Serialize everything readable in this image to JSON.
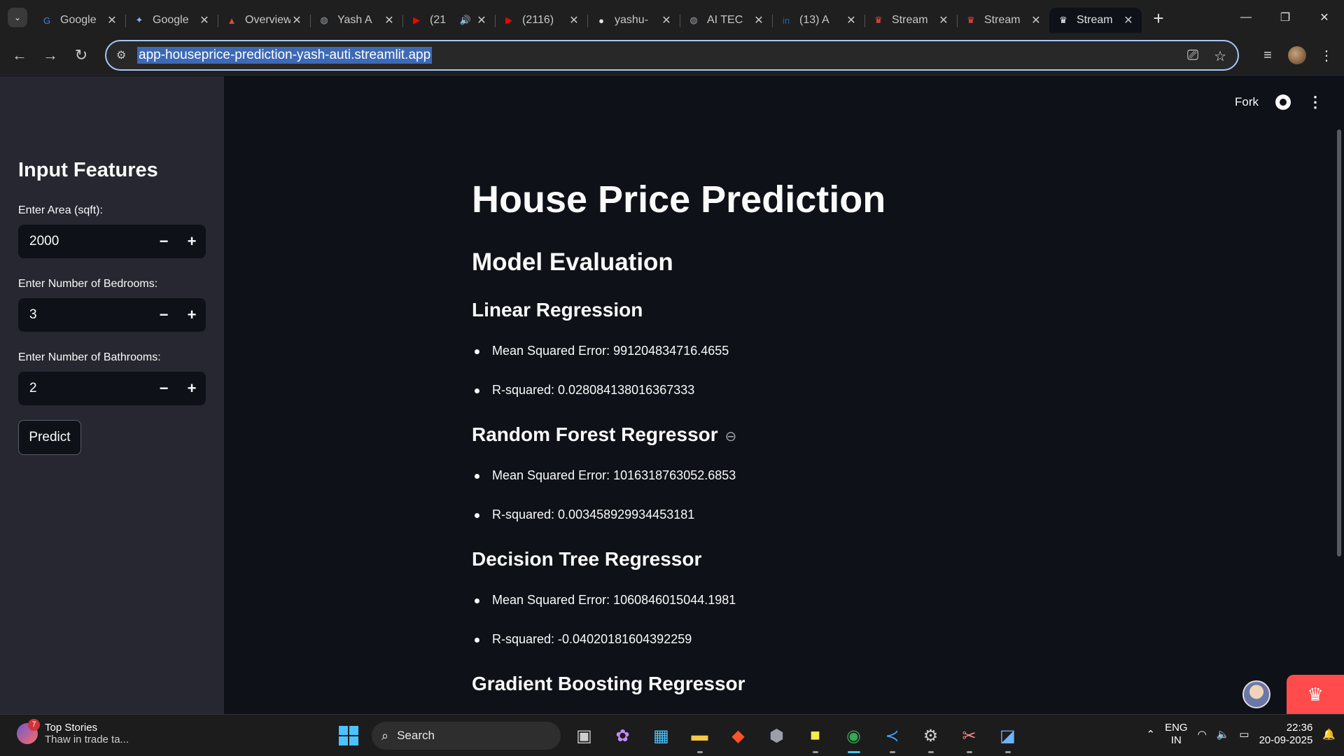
{
  "browser": {
    "tabs": [
      {
        "label": "Google",
        "icon": "google-icon",
        "fav_color": "#4285f4",
        "glyph": "G"
      },
      {
        "label": "Google",
        "icon": "gemini-icon",
        "fav_color": "#8ab4f8",
        "glyph": "✦"
      },
      {
        "label": "Overview",
        "icon": "overview-icon",
        "fav_color": "#e8453c",
        "glyph": "▲"
      },
      {
        "label": "Yash A",
        "icon": "globe-icon",
        "fav_color": "#9aa0a6",
        "glyph": "◍"
      },
      {
        "label": "(21",
        "icon": "youtube-icon",
        "fav_color": "#ff0000",
        "glyph": "▶",
        "audio": "🔊"
      },
      {
        "label": "(2116)",
        "icon": "youtube-icon",
        "fav_color": "#ff0000",
        "glyph": "▶"
      },
      {
        "label": "yashu-",
        "icon": "github-icon",
        "fav_color": "#e3e3e3",
        "glyph": "●"
      },
      {
        "label": "AI TEC",
        "icon": "globe-icon",
        "fav_color": "#9aa0a6",
        "glyph": "◍"
      },
      {
        "label": "(13) A",
        "icon": "linkedin-icon",
        "fav_color": "#0a66c2",
        "glyph": "in"
      },
      {
        "label": "Stream",
        "icon": "streamlit-icon",
        "fav_color": "#ff4b4b",
        "glyph": "♛"
      },
      {
        "label": "Stream",
        "icon": "streamlit-icon",
        "fav_color": "#ff4b4b",
        "glyph": "♛"
      },
      {
        "label": "Stream",
        "icon": "streamlit-icon",
        "fav_color": "#ffffff",
        "glyph": "♛",
        "active": true
      }
    ],
    "url": "app-houseprice-prediction-yash-auti.streamlit.app"
  },
  "sidebar": {
    "title": "Input Features",
    "fields": [
      {
        "label": "Enter Area (sqft):",
        "value": "2000"
      },
      {
        "label": "Enter Number of Bedrooms:",
        "value": "3"
      },
      {
        "label": "Enter Number of Bathrooms:",
        "value": "2"
      }
    ],
    "predict_label": "Predict"
  },
  "header": {
    "fork_label": "Fork"
  },
  "main": {
    "title": "House Price Prediction",
    "section": "Model Evaluation",
    "models": [
      {
        "name": "Linear Regression",
        "mse": "Mean Squared Error: 991204834716.4655",
        "r2": "R-squared: 0.028084138016367333"
      },
      {
        "name": "Random Forest Regressor",
        "mse": "Mean Squared Error: 1016318763052.6853",
        "r2": "R-squared: 0.003458929934453181"
      },
      {
        "name": "Decision Tree Regressor",
        "mse": "Mean Squared Error: 1060846015044.1981",
        "r2": "R-squared: -0.04020181604392259"
      },
      {
        "name": "Gradient Boosting Regressor"
      }
    ]
  },
  "taskbar": {
    "news_title": "Top Stories",
    "news_sub": "Thaw in trade ta...",
    "news_badge": "7",
    "search_label": "Search",
    "lang_1": "ENG",
    "lang_2": "IN",
    "time": "22:36",
    "date": "20-09-2025"
  },
  "colors": {
    "accent": "#ff4b4b",
    "bg": "#0e1117",
    "sidebar": "#262730"
  }
}
